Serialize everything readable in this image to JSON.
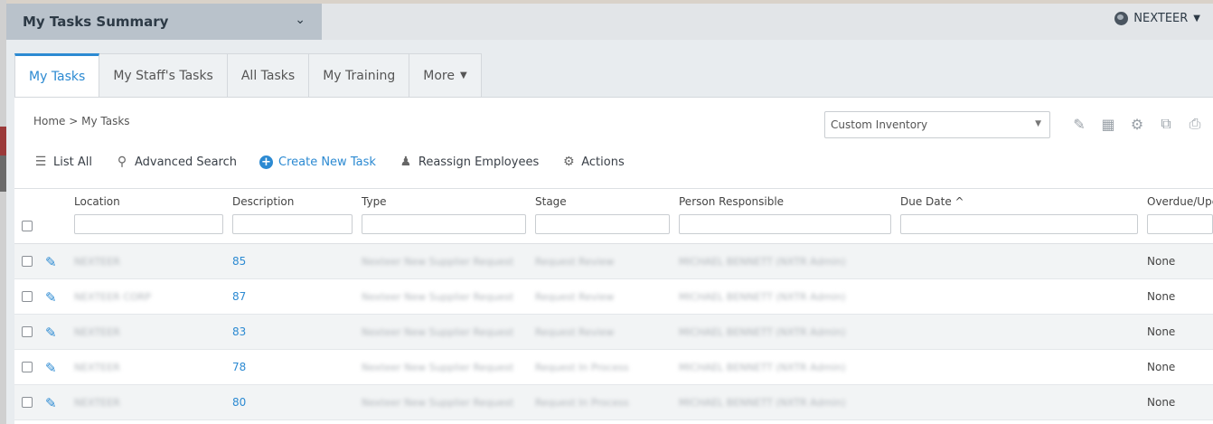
{
  "header": {
    "summary_title": "My Tasks Summary",
    "org_name": "NEXTEER"
  },
  "tabs": [
    {
      "label": "My Tasks",
      "active": true
    },
    {
      "label": "My Staff's Tasks"
    },
    {
      "label": "All Tasks"
    },
    {
      "label": "My Training"
    },
    {
      "label": "More"
    }
  ],
  "breadcrumb": "Home > My Tasks",
  "view_select": {
    "value": "Custom Inventory"
  },
  "actions": {
    "list_all": "List All",
    "advanced_search": "Advanced Search",
    "create_new_task": "Create New Task",
    "reassign_employees": "Reassign Employees",
    "actions": "Actions"
  },
  "table": {
    "columns": [
      "Location",
      "Description",
      "Type",
      "Stage",
      "Person Responsible",
      "Due Date ^",
      "Overdue/Upc"
    ],
    "rows": [
      {
        "location": "NEXTEER",
        "description": "85",
        "type": "Nexteer New Supplier Request",
        "stage": "Request Review",
        "person": "MICHAEL BENNETT (NXTR Admin)",
        "overdue": "None"
      },
      {
        "location": "NEXTEER CORP",
        "description": "87",
        "type": "Nexteer New Supplier Request",
        "stage": "Request Review",
        "person": "MICHAEL BENNETT (NXTR Admin)",
        "overdue": "None"
      },
      {
        "location": "NEXTEER",
        "description": "83",
        "type": "Nexteer New Supplier Request",
        "stage": "Request Review",
        "person": "MICHAEL BENNETT (NXTR Admin)",
        "overdue": "None"
      },
      {
        "location": "NEXTEER",
        "description": "78",
        "type": "Nexteer New Supplier Request",
        "stage": "Request In Process",
        "person": "MICHAEL BENNETT (NXTR Admin)",
        "overdue": "None"
      },
      {
        "location": "NEXTEER",
        "description": "80",
        "type": "Nexteer New Supplier Request",
        "stage": "Request In Process",
        "person": "MICHAEL BENNETT (NXTR Admin)",
        "overdue": "None"
      }
    ]
  },
  "colors": {
    "accent": "#2c8ad2",
    "topbar": "#e2e5e8",
    "summary_bg": "#b9c2cb"
  }
}
